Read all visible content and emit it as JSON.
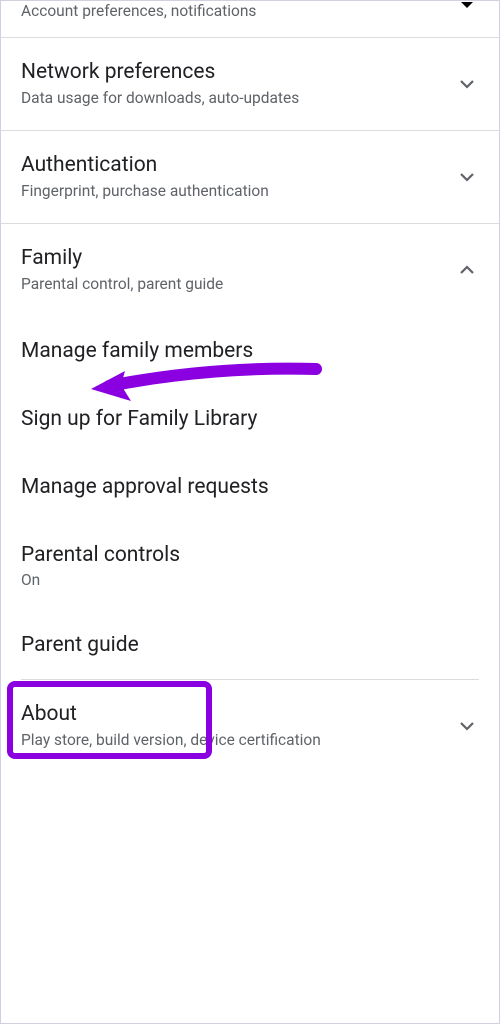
{
  "sections": {
    "general": {
      "subtitle": "Account preferences, notifications"
    },
    "network": {
      "title": "Network preferences",
      "subtitle": "Data usage for downloads, auto-updates"
    },
    "auth": {
      "title": "Authentication",
      "subtitle": "Fingerprint, purchase authentication"
    },
    "family": {
      "title": "Family",
      "subtitle": "Parental control, parent guide",
      "items": [
        {
          "label": "Manage family members"
        },
        {
          "label": "Sign up for Family Library"
        },
        {
          "label": "Manage approval requests"
        },
        {
          "label": "Parental controls",
          "status": "On"
        },
        {
          "label": "Parent guide"
        }
      ]
    },
    "about": {
      "title": "About",
      "subtitle": "Play store, build version, device certification"
    }
  },
  "annotation": {
    "color": "#8a00e0"
  }
}
